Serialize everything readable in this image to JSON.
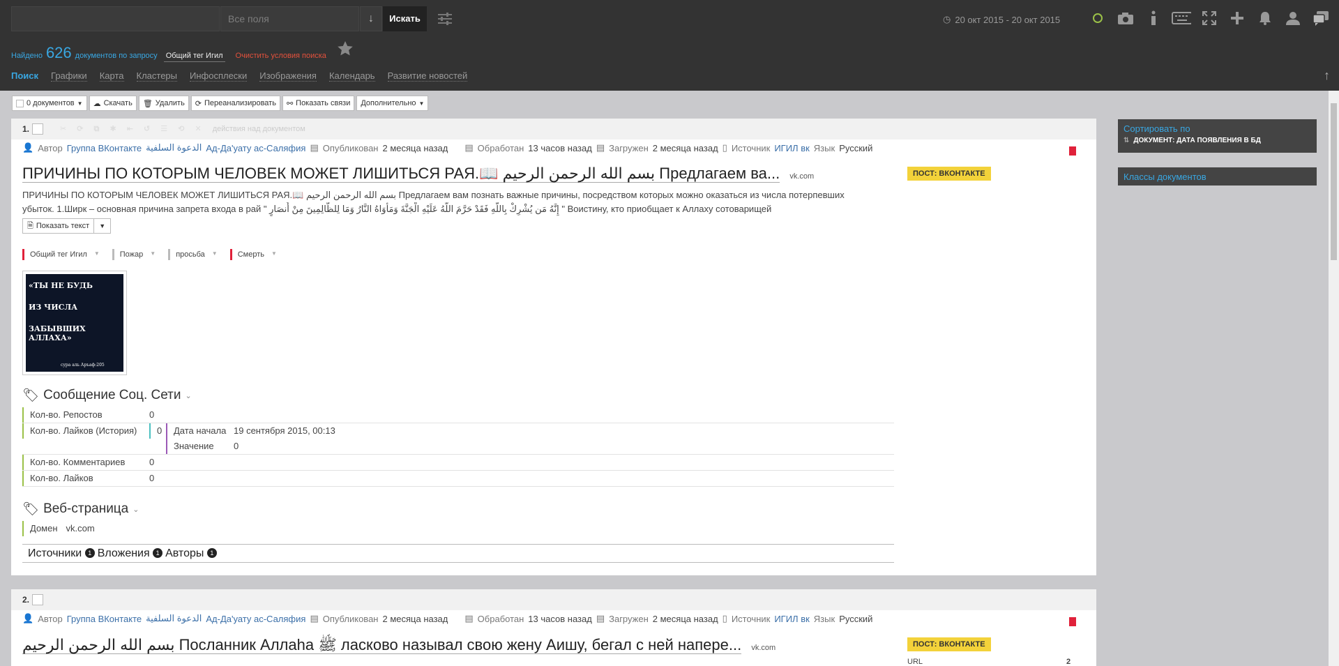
{
  "header": {
    "search_value": "",
    "fields_select": "Все поля",
    "search_button": "Искать",
    "date_range": "20 окт 2015 - 20 окт 2015",
    "found_prefix": "Найдено",
    "found_count": "626",
    "found_suffix": "документов по запросу",
    "query_tag": "Общий тег Игил",
    "clear_label": "Очистить условия поиска",
    "top_icons": [
      "circle-icon",
      "camera-icon",
      "info-icon",
      "keyboard-icon",
      "fullscreen-icon",
      "plus-icon",
      "bell-icon",
      "user-icon",
      "chat-icon"
    ]
  },
  "nav": {
    "tabs": [
      "Поиск",
      "Графики",
      "Карта",
      "Кластеры",
      "Инфосплески",
      "Изображения",
      "Календарь",
      "Развитие новостей"
    ]
  },
  "toolbar": {
    "docs_count": "0 документов",
    "download": "Скачать",
    "delete": "Удалить",
    "reanalyze": "Переанализировать",
    "show_links": "Показать связи",
    "more": "Дополнительно"
  },
  "doc1": {
    "number": "1.",
    "action_text": "действия над документом",
    "author_label": "Автор",
    "author_group": "Группа ВКонтакте",
    "author_arabic": "الدعوة السلفية",
    "author_name": "Ад-Да'уату ас-Саляфия",
    "published_label": "Опубликован",
    "published_value": "2 месяца назад",
    "processed_label": "Обработан",
    "processed_value": "13 часов назад",
    "loaded_label": "Загружен",
    "loaded_value": "2 месяца назад",
    "source_label": "Источник",
    "source_value": "ИГИЛ вк",
    "lang_label": "Язык",
    "lang_value": "Русский",
    "title": "ПРИЧИНЫ ПО КОТОРЫМ ЧЕЛОВЕК МОЖЕТ ЛИШИТЬСЯ РАЯ.📖 بسم الله الرحمن الرحيم Предлагаем ва...",
    "domain": "vk.com",
    "badge": "ПОСТ: ВКОНТАКТЕ",
    "text_line1": "ПРИЧИНЫ ПО КОТОРЫМ ЧЕЛОВЕК МОЖЕТ ЛИШИТЬСЯ РАЯ.📖 بسم الله الرحمن الرحيم Предлагаем вам познать важные причины, посредством которых можно оказаться из числа потерпевших",
    "text_line2": "убыток.  1.Ширк – основная причина запрета входа в рай \" إِنَّهُ مَن يُشْرِكْ بِاللَّهِ فَقَدْ حَرَّمَ اللَّهُ عَلَيْهِ الْجَنَّةَ وَمَأْوَاهُ النَّارُ وَمَا لِلظَّالِمِينَ مِنْ أَنصَارٍ \" Воистину, кто приобщает к Аллаху сотоварищей",
    "show_text": "Показать текст",
    "tags": [
      "Общий тег Игил",
      "Пожар",
      "просьба",
      "Смерть"
    ],
    "image_lines": [
      "«ТЫ НЕ БУДЬ",
      "ИЗ ЧИСЛА",
      "ЗАБЫВШИХ АЛЛАХА»"
    ],
    "image_caption": "сура аль Аръаф:205",
    "social_title": "Сообщение Соц. Сети",
    "reposts_label": "Кол-во. Репостов",
    "reposts_value": "0",
    "likes_hist_label": "Кол-во. Лайков (История)",
    "likes_hist_value": "0",
    "start_date_label": "Дата начала",
    "start_date_value": "19 сентября 2015, 00:13",
    "value_label": "Значение",
    "value_value": "0",
    "comments_label": "Кол-во. Комментариев",
    "comments_value": "0",
    "likes_label": "Кол-во. Лайков",
    "likes_value": "0",
    "web_title": "Веб-страница",
    "domain_label": "Домен",
    "domain_value": "vk.com",
    "bottom_tabs": [
      "Источники",
      "Вложения",
      "Авторы"
    ],
    "bottom_counts": [
      "1",
      "1",
      "1"
    ]
  },
  "doc2": {
    "number": "2.",
    "author_label": "Автор",
    "author_group": "Группа ВКонтакте",
    "author_arabic": "الدعوة السلفية",
    "author_name": "Ад-Да'уату ас-Саляфия",
    "published_label": "Опубликован",
    "published_value": "2 месяца назад",
    "processed_label": "Обработан",
    "processed_value": "13 часов назад",
    "loaded_label": "Загружен",
    "loaded_value": "2 месяца назад",
    "source_label": "Источник",
    "source_value": "ИГИЛ вк",
    "lang_label": "Язык",
    "lang_value": "Русский",
    "title": "بسم الله الرحمن الرحيم Посланник Аллаhа ﷺ ласково называл свою жену Аишу, бегал с ней напере...",
    "domain": "vk.com",
    "badge": "ПОСТ: ВКОНТАКТЕ",
    "url_label": "URL",
    "url_value": "2"
  },
  "right": {
    "sort_label": "Сортировать по",
    "sort_value": "ДОКУМЕНТ: ДАТА ПОЯВЛЕНИЯ В БД",
    "classes_label": "Классы документов"
  },
  "colors": {
    "accent": "#39a7e2",
    "header_bg": "#333333",
    "badge": "#f3d23a",
    "bookmark": "#e0213a"
  }
}
